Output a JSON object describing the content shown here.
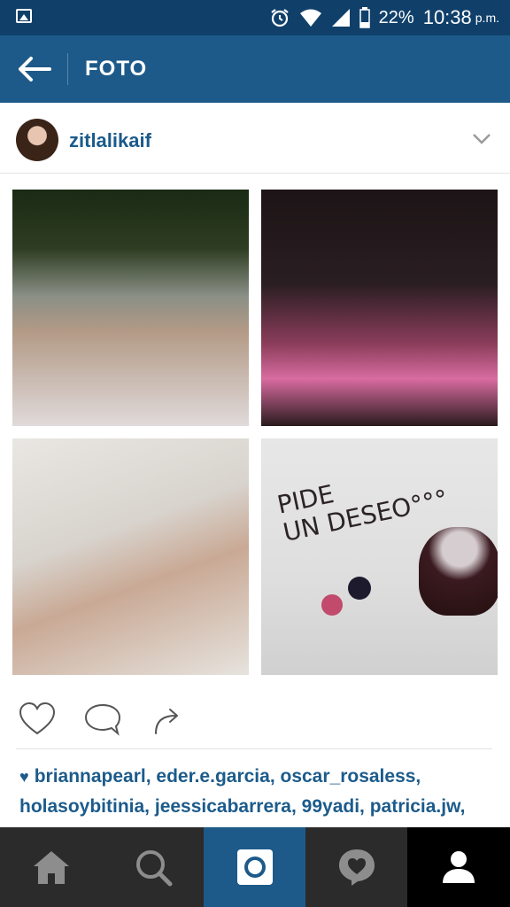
{
  "status_bar": {
    "battery": "22%",
    "time": "10:38",
    "ampm": "p.m."
  },
  "app_bar": {
    "title": "FOTO"
  },
  "post": {
    "username": "zitlalikaif",
    "photo_text": {
      "line1": "PIDE",
      "line2": "UN DESEO°°°"
    },
    "likes_line1": "briannapearl, eder.e.garcia, oscar_rosaless,",
    "likes_line2": "holasoybitinia, jeessicabarrera, 99yadi, patricia.jw,"
  },
  "icons": {
    "image": "image-icon",
    "alarm": "alarm-icon",
    "wifi": "wifi-icon",
    "signal": "signal-icon",
    "battery": "battery-icon",
    "back": "arrow-left-icon",
    "chevron": "chevron-down-icon",
    "like": "heart-icon",
    "comment": "comment-icon",
    "share": "share-icon",
    "home": "home-icon",
    "search": "search-icon",
    "camera": "camera-icon",
    "activity": "activity-heart-icon",
    "profile": "person-icon"
  },
  "colors": {
    "status_bar": "#10406a",
    "app_bar": "#1d5a8a",
    "accent": "#1c5b8b",
    "nav": "#2b2b2b"
  }
}
